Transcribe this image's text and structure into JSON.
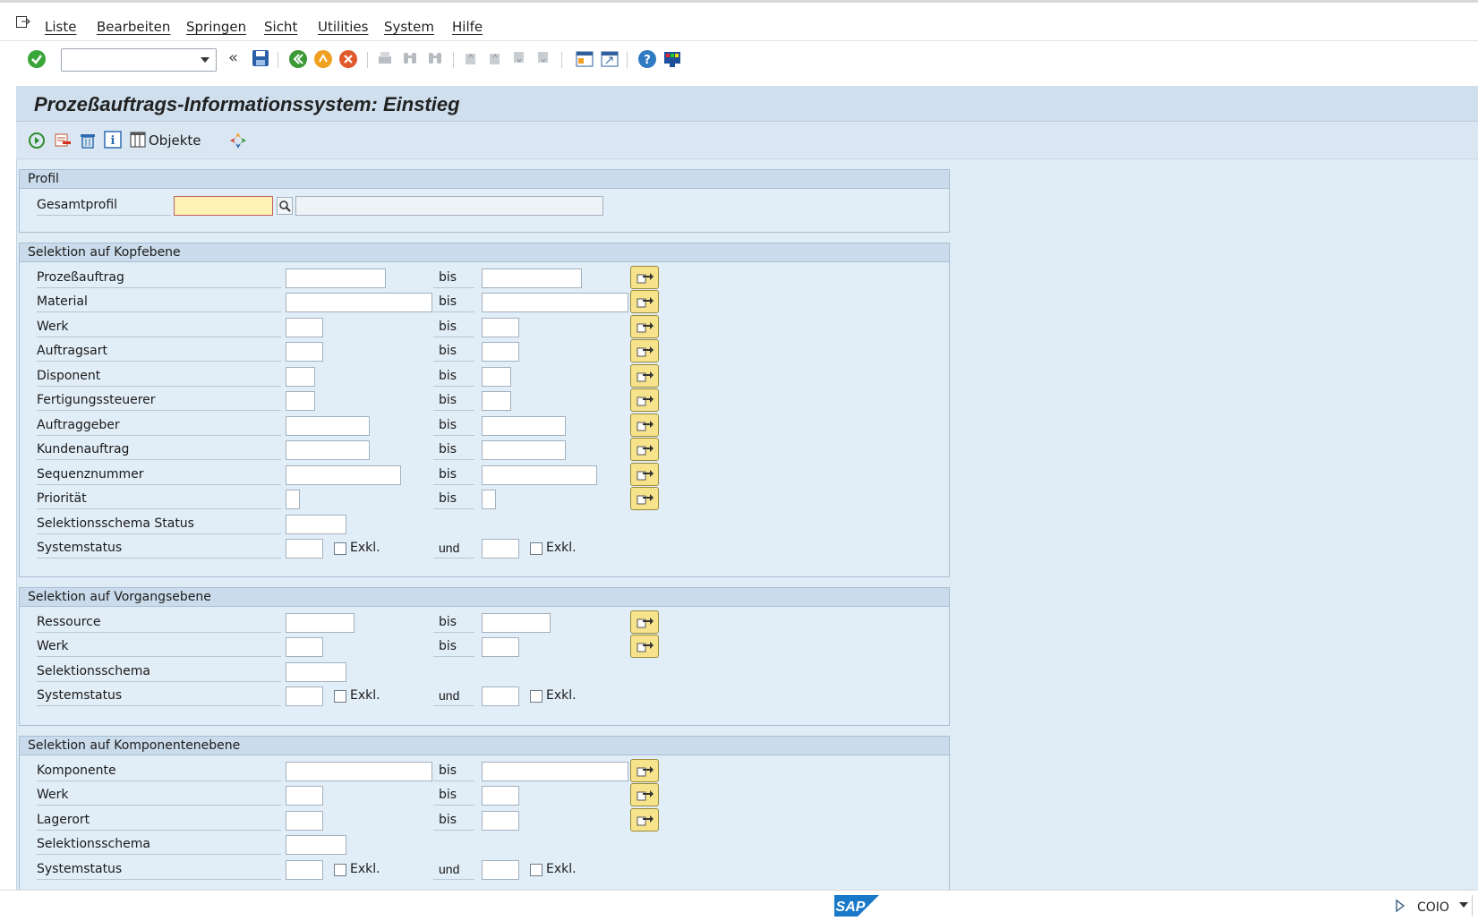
{
  "menu": [
    "Liste",
    "Bearbeiten",
    "Springen",
    "Sicht",
    "Utilities",
    "System",
    "Hilfe"
  ],
  "title": "Prozeßauftrags-Informationssystem: Einstieg",
  "app_toolbar": {
    "objects_label": "Objekte"
  },
  "profil": {
    "header": "Profil",
    "label": "Gesamtprofil",
    "value": "",
    "description": ""
  },
  "kopf": {
    "header": "Selektion auf Kopfebene",
    "rows": [
      {
        "label": "Prozeßauftrag",
        "from": "",
        "bis": "bis",
        "to": ""
      },
      {
        "label": "Material",
        "from": "",
        "bis": "bis",
        "to": ""
      },
      {
        "label": "Werk",
        "from": "",
        "bis": "bis",
        "to": ""
      },
      {
        "label": "Auftragsart",
        "from": "",
        "bis": "bis",
        "to": ""
      },
      {
        "label": "Disponent",
        "from": "",
        "bis": "bis",
        "to": ""
      },
      {
        "label": "Fertigungssteuerer",
        "from": "",
        "bis": "bis",
        "to": ""
      },
      {
        "label": "Auftraggeber",
        "from": "",
        "bis": "bis",
        "to": ""
      },
      {
        "label": "Kundenauftrag",
        "from": "",
        "bis": "bis",
        "to": ""
      },
      {
        "label": "Sequenznummer",
        "from": "",
        "bis": "bis",
        "to": ""
      },
      {
        "label": "Priorität",
        "from": "",
        "bis": "bis",
        "to": ""
      },
      {
        "label": "Selektionsschema Status",
        "from": ""
      },
      {
        "label": "Systemstatus",
        "from": "",
        "exkl1": "Exkl.",
        "und": "und",
        "to": "",
        "exkl2": "Exkl."
      }
    ]
  },
  "vorgang": {
    "header": "Selektion auf Vorgangsebene",
    "rows": [
      {
        "label": "Ressource",
        "bis": "bis"
      },
      {
        "label": "Werk",
        "bis": "bis"
      },
      {
        "label": "Selektionsschema"
      },
      {
        "label": "Systemstatus",
        "exkl1": "Exkl.",
        "und": "und",
        "exkl2": "Exkl."
      }
    ]
  },
  "komponente": {
    "header": "Selektion auf Komponentenebene",
    "rows": [
      {
        "label": "Komponente",
        "bis": "bis"
      },
      {
        "label": "Werk",
        "bis": "bis"
      },
      {
        "label": "Lagerort",
        "bis": "bis"
      },
      {
        "label": "Selektionsschema"
      },
      {
        "label": "Systemstatus",
        "exkl1": "Exkl.",
        "und": "und",
        "exkl2": "Exkl."
      }
    ]
  },
  "status": {
    "transaction": "COIO",
    "logo": "SAP"
  },
  "icons": {
    "toolbar": [
      "enter-icon",
      "back-icon",
      "save-icon",
      "previous-icon",
      "exit-icon",
      "cancel-icon",
      "print-icon",
      "find-icon",
      "find-next-icon",
      "first-page-icon",
      "previous-page-icon",
      "next-page-icon",
      "last-page-icon",
      "create-session-icon",
      "shortcut-icon",
      "help-icon",
      "customize-icon"
    ],
    "app": [
      "execute-icon",
      "delete-row-icon",
      "trash-icon",
      "info-icon",
      "objects-icon",
      "variant-icon"
    ]
  },
  "colors": {
    "accent_yellow": "#f6e38c",
    "background": "#dfebf5",
    "header": "#cadbeb",
    "focus_field": "#fdf1b4"
  }
}
